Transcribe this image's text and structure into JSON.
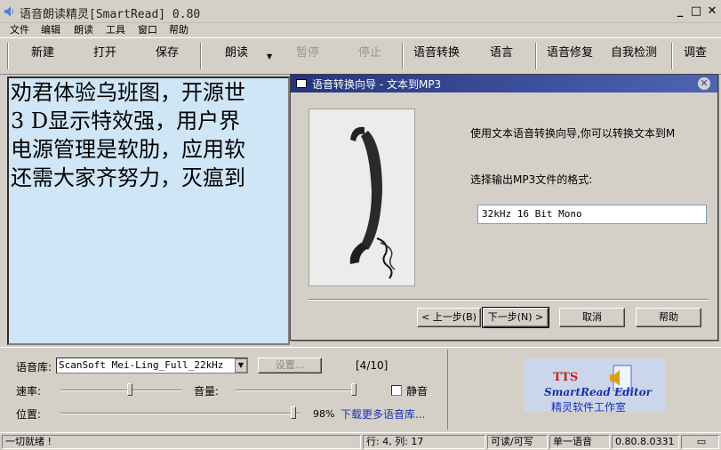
{
  "window": {
    "title": "语音朗读精灵[SmartRead] 0.80"
  },
  "menu": [
    "文件",
    "编辑",
    "朗读",
    "工具",
    "窗口",
    "帮助"
  ],
  "toolbar": {
    "new": "新建",
    "open": "打开",
    "save": "保存",
    "read": "朗读",
    "pause": "暂停",
    "stop": "停止",
    "convert": "语音转换",
    "language": "语言",
    "repair": "语音修复",
    "selftest": "自我检测",
    "survey": "调查"
  },
  "editor": {
    "lines": [
      "劝君体验乌班图，开源世",
      " 3 D显示特效强，用户界",
      "电源管理是软肋，应用软",
      "还需大家齐努力，灭瘟到"
    ]
  },
  "dialog": {
    "title": "语音转换向导 - 文本到MP3",
    "intro": "使用文本语音转换向导,你可以转换文本到M",
    "format_label": "选择输出MP3文件的格式:",
    "format_value": "32kHz 16 Bit Mono",
    "back": "< 上一步(B)",
    "next": "下一步(N) >",
    "cancel": "取消",
    "help": "帮助"
  },
  "controls": {
    "voice_label": "语音库:",
    "voice_value": "ScanSoft Mei-Ling_Full_22kHz",
    "settings_button": "设置...",
    "voice_count": "[4/10]",
    "rate_label": "速率:",
    "rate": 0.58,
    "volume_label": "音量:",
    "volume": 1.0,
    "mute_label": "静音",
    "position_label": "位置:",
    "position": 0.98,
    "position_pct": "98%",
    "download_link": "下载更多语音库..."
  },
  "logo": {
    "tts": "TTS",
    "name": "SmartRead Editor",
    "studio": "精灵软件工作室"
  },
  "statusbar": {
    "message": "一切就绪 !",
    "cursor": "行: 4, 列: 17",
    "mode": "可读/可写",
    "voice_mode": "单一语音",
    "version": "0.80.8.0331"
  },
  "colors": {
    "editor_bg": "#cfe6f7",
    "dialog_title": "#2f3f8f",
    "link": "#1a2fb0",
    "logo_text": "#1a2fb0",
    "tts_red": "#d02020"
  }
}
